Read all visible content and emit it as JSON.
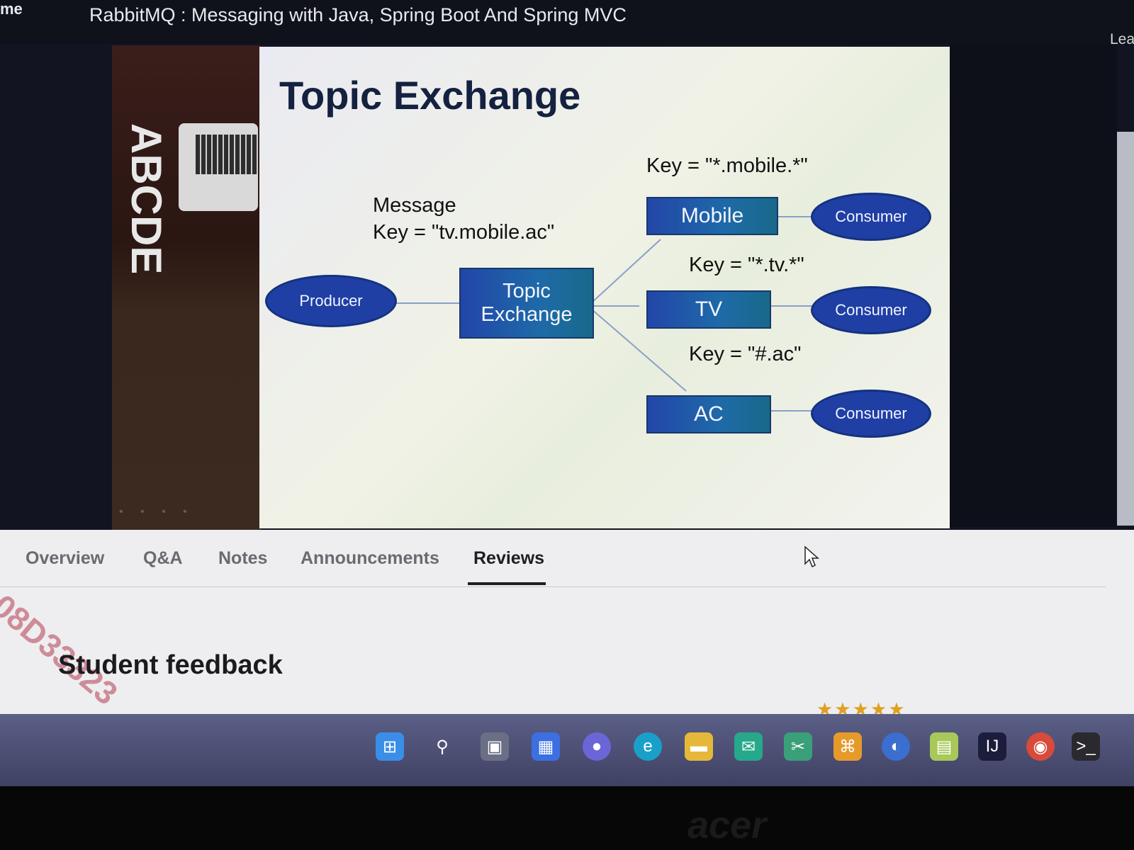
{
  "window": {
    "left_fragment": "me",
    "course_title": "RabbitMQ : Messaging with Java, Spring Boot And Spring MVC",
    "right_fragment": "Lea"
  },
  "webcam": {
    "letters": "ABCDE"
  },
  "slide": {
    "title": "Topic Exchange",
    "message_label": "Message",
    "message_key": "Key  =  \"tv.mobile.ac\"",
    "producer": "Producer",
    "exchange": "Topic Exchange",
    "queues": [
      {
        "key": "Key  =  \"*.mobile.*\"",
        "name": "Mobile",
        "consumer": "Consumer"
      },
      {
        "key": "Key  =  \"*.tv.*\"",
        "name": "TV",
        "consumer": "Consumer"
      },
      {
        "key": "Key  =  \"#.ac\"",
        "name": "AC",
        "consumer": "Consumer"
      }
    ]
  },
  "tabs": [
    "Overview",
    "Q&A",
    "Notes",
    "Announcements",
    "Reviews"
  ],
  "active_tab": "Reviews",
  "section": {
    "title": "Student feedback"
  },
  "watermark": "08D33323",
  "taskbar": {
    "icons": [
      "windows-start-icon",
      "search-icon",
      "task-view-icon",
      "widgets-icon",
      "teams-chat-icon",
      "edge-icon",
      "file-explorer-icon",
      "mail-icon",
      "snipping-tool-icon",
      "app-icon",
      "vpn-icon",
      "notepad-icon",
      "intellij-icon",
      "chrome-icon",
      "terminal-icon"
    ]
  },
  "brand": "acer"
}
